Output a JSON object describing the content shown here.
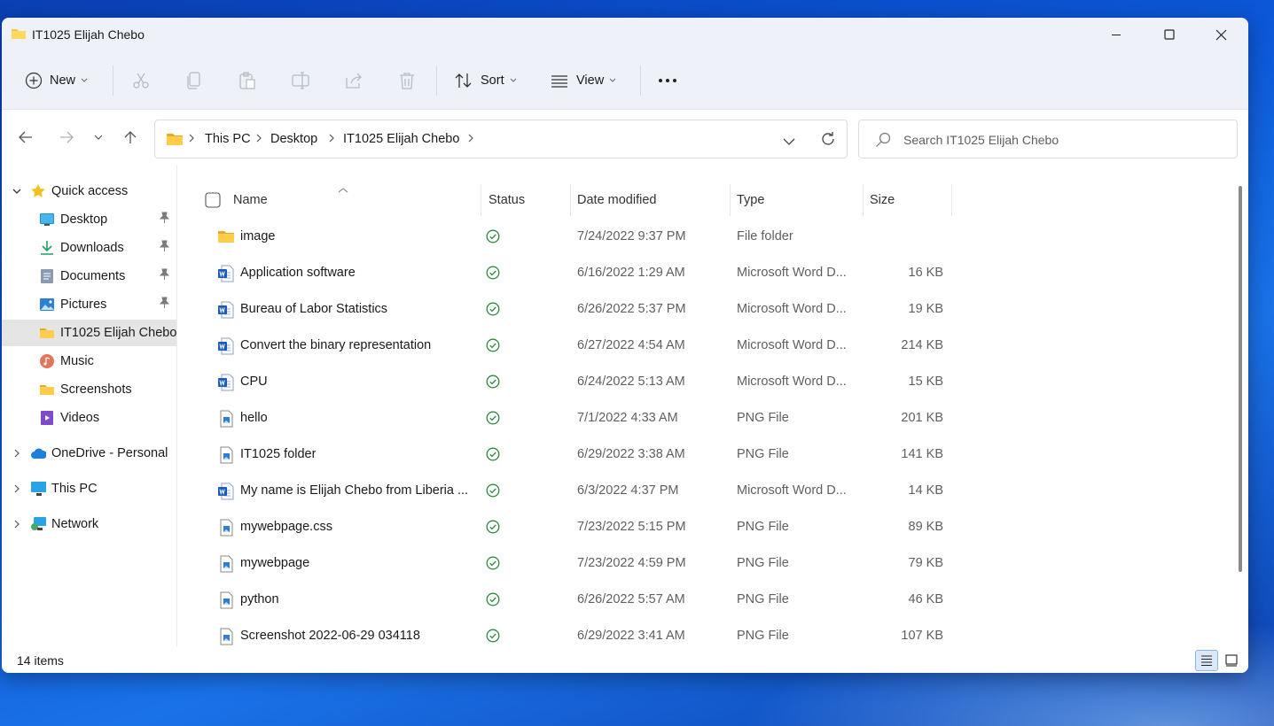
{
  "window": {
    "title": "IT1025 Elijah Chebo",
    "controls": [
      "minimize-icon",
      "maximize-icon",
      "close-icon"
    ]
  },
  "toolbar": {
    "new_label": "New",
    "sort_label": "Sort",
    "view_label": "View",
    "icons": [
      "cut-icon",
      "copy-icon",
      "paste-icon",
      "rename-icon",
      "share-icon",
      "delete-icon",
      "more-icon"
    ]
  },
  "address": {
    "crumbs": [
      "This PC",
      "Desktop",
      "IT1025 Elijah Chebo"
    ],
    "search_placeholder": "Search IT1025 Elijah Chebo"
  },
  "sidebar": {
    "sections": [
      {
        "label": "Quick access",
        "icon": "star-icon",
        "expanded": true
      },
      {
        "label": "OneDrive - Personal",
        "icon": "cloud-icon",
        "expanded": false
      },
      {
        "label": "This PC",
        "icon": "monitor-icon",
        "expanded": false
      },
      {
        "label": "Network",
        "icon": "network-icon",
        "expanded": false
      }
    ],
    "quick_items": [
      {
        "label": "Desktop",
        "icon": "desktop-icon",
        "pinned": true
      },
      {
        "label": "Downloads",
        "icon": "download-icon",
        "pinned": true
      },
      {
        "label": "Documents",
        "icon": "document-icon",
        "pinned": true
      },
      {
        "label": "Pictures",
        "icon": "picture-icon",
        "pinned": true
      },
      {
        "label": "IT1025 Elijah Chebo",
        "icon": "folder-icon",
        "pinned": false,
        "selected": true
      },
      {
        "label": "Music",
        "icon": "music-icon",
        "pinned": false
      },
      {
        "label": "Screenshots",
        "icon": "folder-icon",
        "pinned": false
      },
      {
        "label": "Videos",
        "icon": "video-icon",
        "pinned": false
      }
    ]
  },
  "columns": {
    "name": "Name",
    "status": "Status",
    "date": "Date modified",
    "type": "Type",
    "size": "Size"
  },
  "files": [
    {
      "name": "image",
      "date": "7/24/2022 9:37 PM",
      "type": "File folder",
      "size": "",
      "kind": "folder"
    },
    {
      "name": "Application software",
      "date": "6/16/2022 1:29 AM",
      "type": "Microsoft Word D...",
      "size": "16 KB",
      "kind": "word"
    },
    {
      "name": "Bureau of Labor Statistics",
      "date": "6/26/2022 5:37 PM",
      "type": "Microsoft Word D...",
      "size": "19 KB",
      "kind": "word"
    },
    {
      "name": "Convert the binary representation",
      "date": "6/27/2022 4:54 AM",
      "type": "Microsoft Word D...",
      "size": "214 KB",
      "kind": "word"
    },
    {
      "name": "CPU",
      "date": "6/24/2022 5:13 AM",
      "type": "Microsoft Word D...",
      "size": "15 KB",
      "kind": "word"
    },
    {
      "name": "hello",
      "date": "7/1/2022 4:33 AM",
      "type": "PNG File",
      "size": "201 KB",
      "kind": "png"
    },
    {
      "name": "IT1025 folder",
      "date": "6/29/2022 3:38 AM",
      "type": "PNG File",
      "size": "141 KB",
      "kind": "png"
    },
    {
      "name": "My name is Elijah Chebo from Liberia ...",
      "date": "6/3/2022 4:37 PM",
      "type": "Microsoft Word D...",
      "size": "14 KB",
      "kind": "word"
    },
    {
      "name": "mywebpage.css",
      "date": "7/23/2022 5:15 PM",
      "type": "PNG File",
      "size": "89 KB",
      "kind": "png"
    },
    {
      "name": "mywebpage",
      "date": "7/23/2022 4:59 PM",
      "type": "PNG File",
      "size": "79 KB",
      "kind": "png"
    },
    {
      "name": "python",
      "date": "6/26/2022 5:57 AM",
      "type": "PNG File",
      "size": "46 KB",
      "kind": "png"
    },
    {
      "name": "Screenshot 2022-06-29 034118",
      "date": "6/29/2022 3:41 AM",
      "type": "PNG File",
      "size": "107 KB",
      "kind": "png"
    }
  ],
  "statusbar": {
    "item_count": "14 items"
  },
  "colors": {
    "accent": "#0067c0",
    "status_green": "#2e8b3e",
    "folder": "#f4c63b",
    "word_blue": "#185abd"
  }
}
